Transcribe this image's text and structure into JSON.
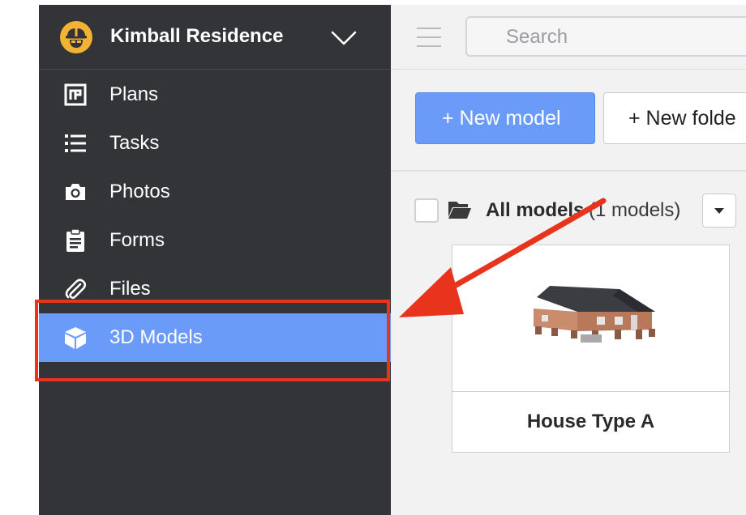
{
  "project": {
    "name": "Kimball Residence",
    "logo_icon": "hardhat-worker-icon",
    "chevron_icon": "chevron-down-icon"
  },
  "sidebar": {
    "items": [
      {
        "label": "Plans",
        "icon": "plans-icon"
      },
      {
        "label": "Tasks",
        "icon": "list-icon"
      },
      {
        "label": "Photos",
        "icon": "camera-icon"
      },
      {
        "label": "Forms",
        "icon": "clipboard-icon"
      },
      {
        "label": "Files",
        "icon": "paperclip-icon"
      },
      {
        "label": "3D Models",
        "icon": "cube-icon",
        "active": true
      }
    ]
  },
  "topbar": {
    "search_placeholder": "Search"
  },
  "toolbar": {
    "new_model_label": "+ New model",
    "new_folder_label": "+ New folde"
  },
  "folder": {
    "title": "All models",
    "count": "(1 models)"
  },
  "models": [
    {
      "name": "House Type A"
    }
  ],
  "colors": {
    "sidebar_bg": "#333437",
    "active_item": "#6b9bf8",
    "primary_button": "#6b9bf8",
    "annotation_red": "#e8341c"
  }
}
